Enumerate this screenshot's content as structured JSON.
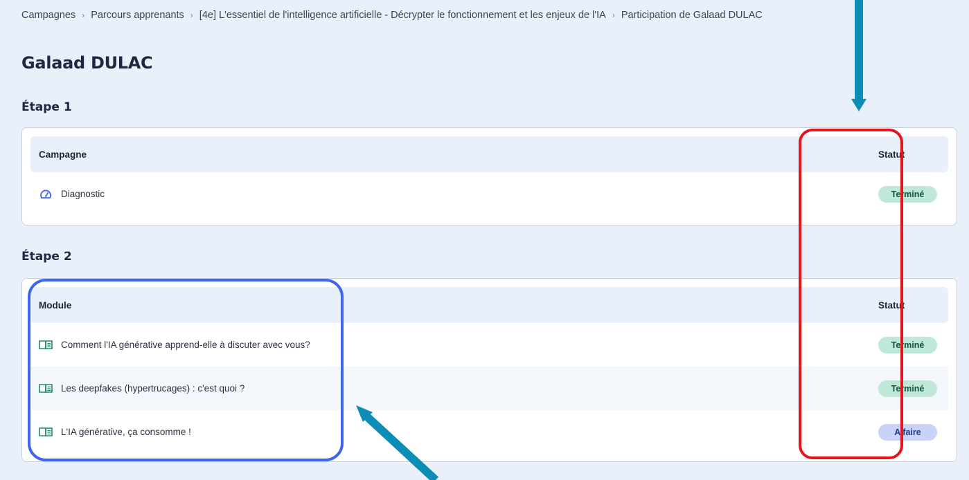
{
  "breadcrumb": {
    "items": [
      "Campagnes",
      "Parcours apprenants",
      "[4e] L'essentiel de l'intelligence artificielle - Décrypter le fonctionnement et les enjeux de l'IA",
      "Participation de Galaad DULAC"
    ],
    "separator": "›"
  },
  "page": {
    "title": "Galaad DULAC"
  },
  "step1": {
    "title": "Étape 1",
    "header": {
      "col1": "Campagne",
      "col2": "Statut"
    },
    "rows": [
      {
        "icon": "gauge-icon",
        "label": "Diagnostic",
        "status": "Terminé",
        "status_kind": "done"
      }
    ]
  },
  "step2": {
    "title": "Étape 2",
    "header": {
      "col1": "Module",
      "col2": "Statut"
    },
    "rows": [
      {
        "icon": "book-icon",
        "label": "Comment l'IA générative apprend-elle à discuter avec vous?",
        "status": "Terminé",
        "status_kind": "done"
      },
      {
        "icon": "book-icon",
        "label": "Les deepfakes (hypertrucages) : c'est quoi ?",
        "status": "Terminé",
        "status_kind": "done"
      },
      {
        "icon": "book-icon",
        "label": "L'IA générative, ça consomme !",
        "status": "A faire",
        "status_kind": "todo"
      }
    ]
  },
  "colors": {
    "background": "#eaf0f9",
    "badge_done_bg": "#bfe8d8",
    "badge_todo_bg": "#c9d3f7",
    "annotation_red": "#e5141c",
    "annotation_blue": "#3f64ee",
    "annotation_arrow": "#0b8db5"
  }
}
